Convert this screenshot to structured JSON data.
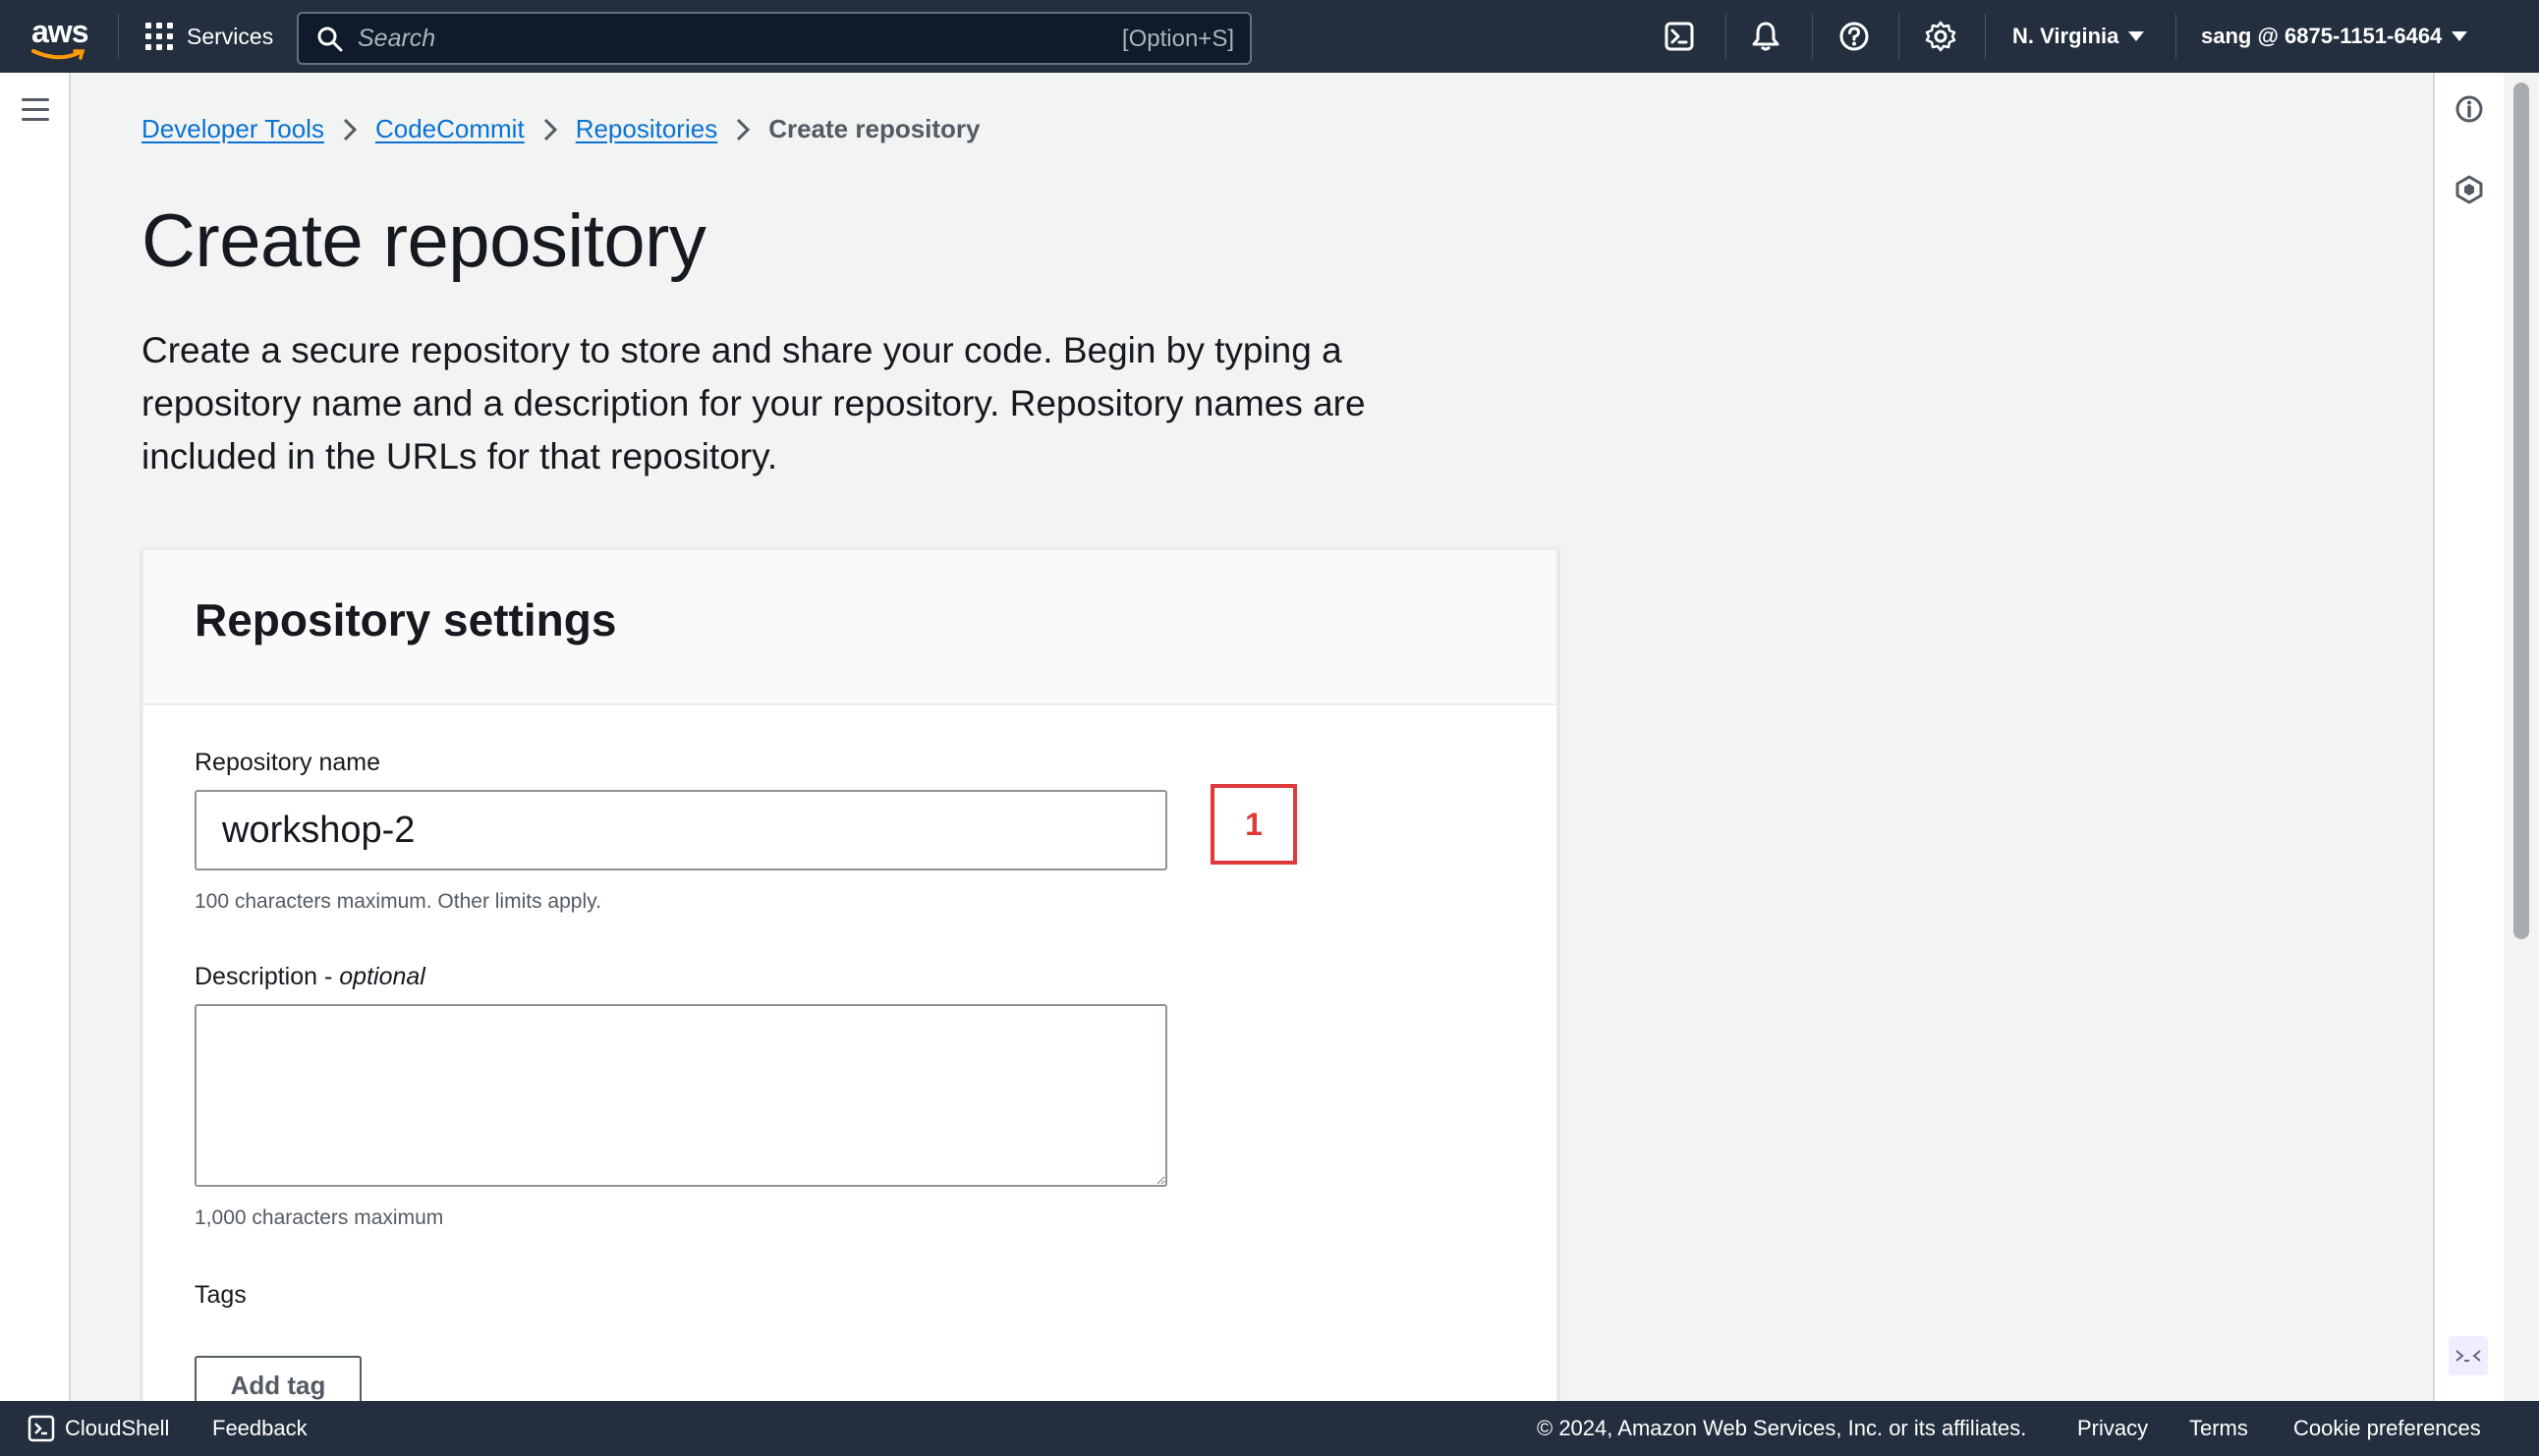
{
  "topnav": {
    "logo_text": "aws",
    "services_label": "Services",
    "search_placeholder": "Search",
    "search_shortcut": "[Option+S]",
    "region_label": "N. Virginia",
    "account_label": "sang @ 6875-1151-6464",
    "icons": [
      "cloudshell-icon",
      "bell-icon",
      "help-icon",
      "gear-icon"
    ]
  },
  "breadcrumb": {
    "items": [
      "Developer Tools",
      "CodeCommit",
      "Repositories"
    ],
    "current": "Create repository"
  },
  "page": {
    "title": "Create repository",
    "description": "Create a secure repository to store and share your code. Begin by typing a repository name and a description for your repository. Repository names are included in the URLs for that repository."
  },
  "repo_settings": {
    "title": "Repository settings",
    "name_label": "Repository name",
    "name_value": "workshop-2",
    "name_hint": "100 characters maximum. Other limits apply.",
    "description_label": "Description - ",
    "description_optional": "optional",
    "description_value": "",
    "description_hint": "1,000 characters maximum",
    "tags_label": "Tags",
    "add_tag_label": "Add tag"
  },
  "annotation": {
    "label": "1",
    "color": "#e0393b"
  },
  "footer": {
    "cloudshell_label": "CloudShell",
    "feedback_label": "Feedback",
    "copyright": "© 2024, Amazon Web Services, Inc. or its affiliates.",
    "privacy_label": "Privacy",
    "terms_label": "Terms",
    "cookie_label": "Cookie preferences"
  },
  "colors": {
    "nav_bg": "#232f3e",
    "link": "#0972d3",
    "page_bg": "#f2f3f3"
  }
}
